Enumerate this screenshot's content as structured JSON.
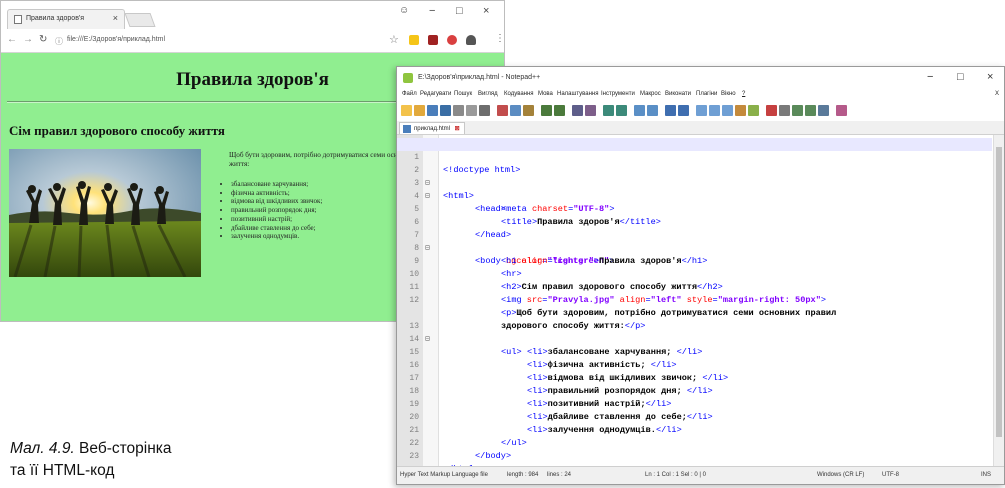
{
  "browser": {
    "tab_title": "Правила здоров'я",
    "tab_close": "×",
    "url": "file:///E:/Здоров'я/приклад.html",
    "window_controls": [
      "−",
      "□",
      "×"
    ],
    "page": {
      "bgcolor": "#90ee90",
      "heading": "Правила здоров'я",
      "subheading": "Сім правил здорового способу життя",
      "paragraph": "Щоб бути здоровим, потрібно дотримуватися семи основних правил здорового способу життя:",
      "list": [
        "збалансоване харчування;",
        "фізична активність;",
        "відмова від шкідливих звичок;",
        "правильний розпорядок дня;",
        "позитивний настрій;",
        "дбайливе ставлення до себе;",
        "залучення однодумців."
      ]
    }
  },
  "notepad": {
    "title": "E:\\Здоров'я\\приклад.html - Notepad++",
    "window_controls": [
      "−",
      "□",
      "×"
    ],
    "close_doc": "X",
    "menu": [
      "Файл",
      "Редагувати",
      "Пошук",
      "Вигляд",
      "Кодування",
      "Мова",
      "Налаштування",
      "Інструменти",
      "Макрос",
      "Виконати",
      "Плагіни",
      "Вікно",
      "?"
    ],
    "tab": "приклад.html",
    "code_lines": [
      "<!doctype html>",
      "<html>",
      "<head>",
      "<meta charset=\"UTF-8\">",
      "<title>Правила здоров'я</title>",
      "</head>",
      "<body bgcolor=\"lightgreen\">",
      "<h1 align=\"center\">Правила здоров'я</h1>",
      "<hr>",
      "<h2>Сім правил здорового способу життя</h2>",
      "<img src=\"Pravyla.jpg\" align=\"left\" style=\"margin-right: 50px\">",
      "<p>Щоб бути здоровим, потрібно дотримуватися семи основних правил",
      "здорового способу життя:</p>",
      "<ul>",
      "<li>збалансоване харчування; </li>",
      "<li>фізична активність; </li>",
      "<li>відмова від шкідливих звичок; </li>",
      "<li>правильний розпорядок дня; </li>",
      "<li>позитивний настрій;</li>",
      "<li>дбайливе ставлення до себе;</li>",
      "<li>залучення однодумців.</li>",
      "</ul>",
      "</body>",
      "</html>"
    ],
    "line_numbers": [
      "1",
      "2",
      "3",
      "4",
      "5",
      "6",
      "7",
      "8",
      "9",
      "10",
      "11",
      "12",
      "",
      "13",
      "14",
      "15",
      "16",
      "17",
      "18",
      "19",
      "20",
      "21",
      "22",
      "23"
    ],
    "status": {
      "lang": "Hyper Text Markup Language file",
      "length": "length : 984",
      "lines": "lines : 24",
      "pos": "Ln : 1    Col : 1    Sel : 0 | 0",
      "eol": "Windows (CR LF)",
      "enc": "UTF-8",
      "mode": "INS"
    }
  },
  "caption": {
    "label": "Мал. 4.9.",
    "text_line1": " Веб-сторінка",
    "text_line2": "та її HTML-код"
  }
}
